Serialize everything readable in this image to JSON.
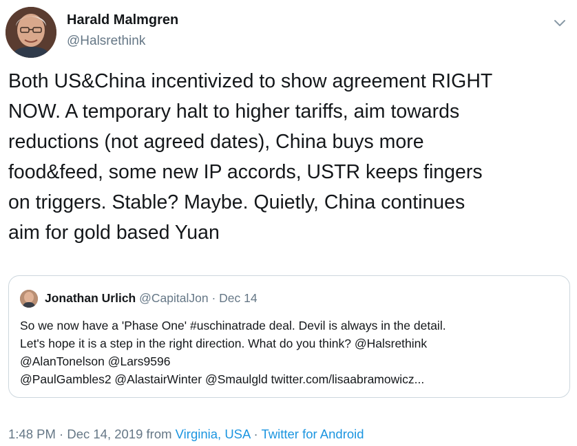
{
  "author": {
    "name": "Harald Malmgren",
    "handle": "@Halsrethink"
  },
  "menu_icon": "chevron-down-icon",
  "tweet_text": "Both US&China incentivized to show agreement RIGHT\nNOW. A temporary halt to higher tariffs, aim towards\nreductions (not agreed dates), China buys more\nfood&feed, some new IP accords, USTR keeps fingers\non triggers. Stable? Maybe. Quietly, China continues\naim for gold based Yuan",
  "quoted_tweet": {
    "name": "Jonathan Urlich",
    "handle": "@CapitalJon",
    "separator": "·",
    "date": "Dec 14",
    "text": "So we now have a 'Phase One' #uschinatrade deal. Devil is always in the detail.\nLet's hope it is a step in the right direction. What do you think? @Halsrethink\n@AlanTonelson @Lars9596\n@PaulGambles2 @AlastairWinter @Smaulgld twitter.com/lisaabramowicz..."
  },
  "footer": {
    "timestamp": "1:48 PM · Dec 14, 2019 from ",
    "location": "Virginia, USA",
    "separator": " · ",
    "source": "Twitter for Android"
  },
  "colors": {
    "text": "#14171a",
    "secondary": "#657786",
    "link": "#1b95e0",
    "border": "#ccd6dd"
  }
}
